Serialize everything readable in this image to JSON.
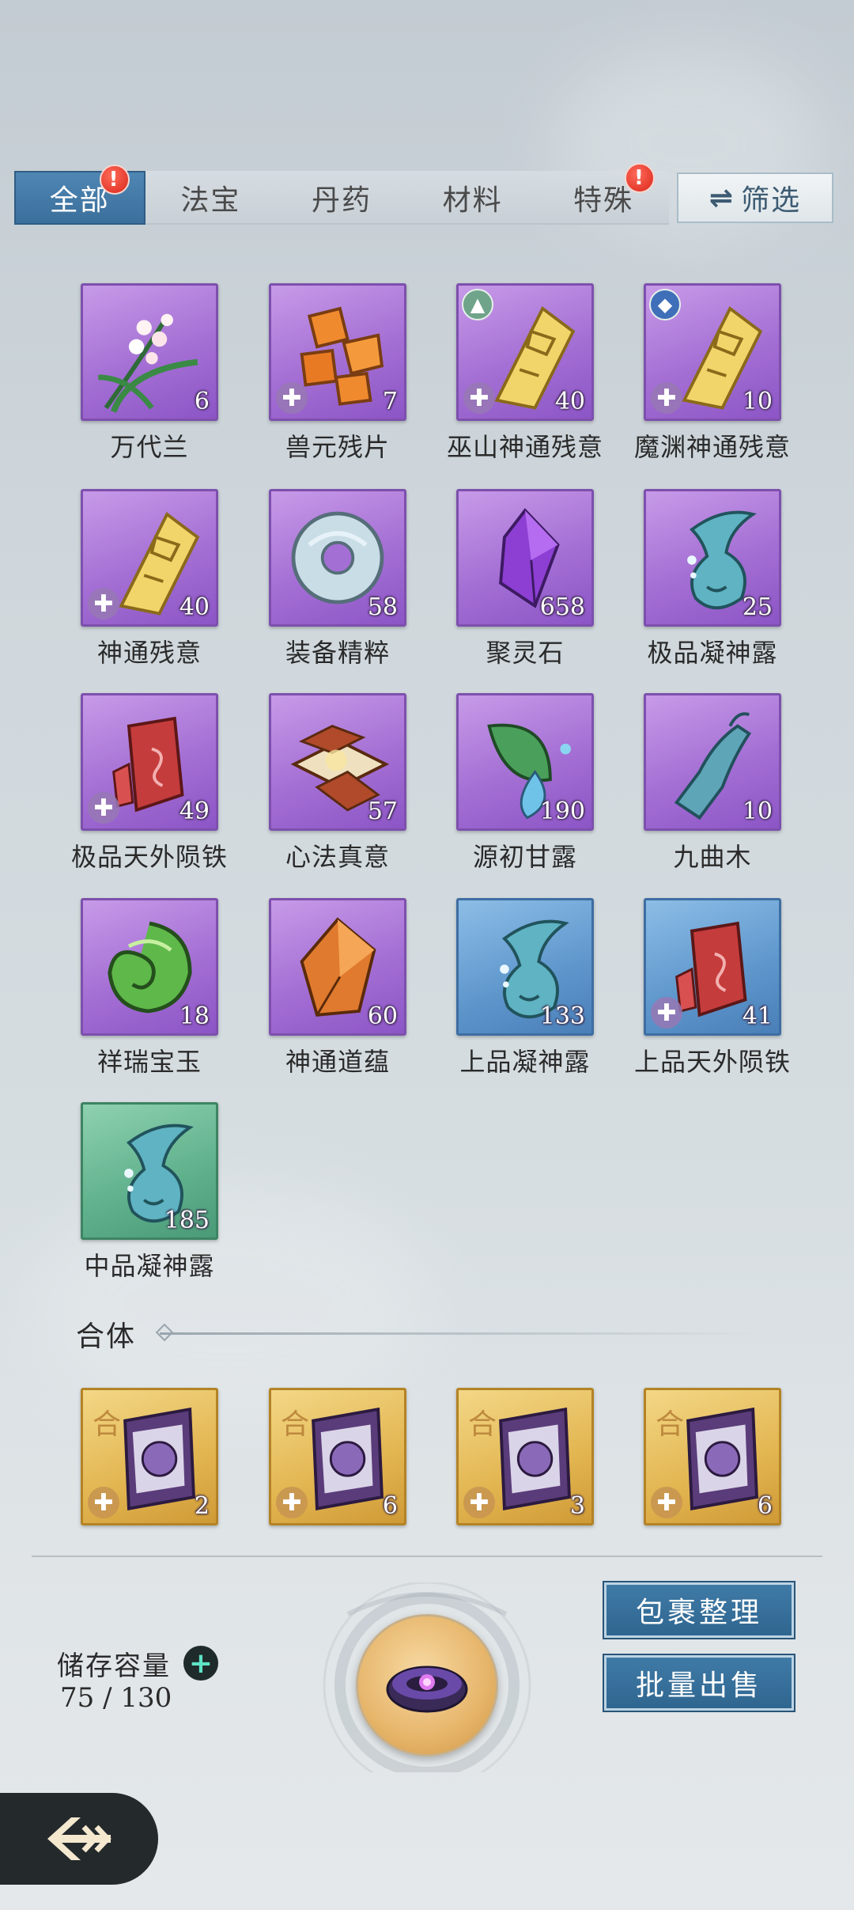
{
  "tabs": [
    {
      "label": "全部",
      "active": true,
      "badge": "!"
    },
    {
      "label": "法宝",
      "active": false,
      "badge": ""
    },
    {
      "label": "丹药",
      "active": false,
      "badge": ""
    },
    {
      "label": "材料",
      "active": false,
      "badge": ""
    },
    {
      "label": "特殊",
      "active": false,
      "badge": "!"
    }
  ],
  "filter": {
    "icon": "swap-arrows-icon",
    "label": "筛选"
  },
  "items": [
    {
      "name": "万代兰",
      "qty": "6",
      "rarity": "purple",
      "icon": "orchid-icon",
      "fragment": false
    },
    {
      "name": "兽元残片",
      "qty": "7",
      "rarity": "purple",
      "icon": "beast-shard-icon",
      "fragment": true
    },
    {
      "name": "巫山神通残意",
      "qty": "40",
      "rarity": "purple",
      "icon": "scroll-fragment-icon",
      "fragment": true,
      "sect": "mountain"
    },
    {
      "name": "魔渊神通残意",
      "qty": "10",
      "rarity": "purple",
      "icon": "scroll-fragment-icon",
      "fragment": true,
      "sect": "abyss"
    },
    {
      "name": "神通残意",
      "qty": "40",
      "rarity": "purple",
      "icon": "scroll-fragment-icon",
      "fragment": true
    },
    {
      "name": "装备精粹",
      "qty": "58",
      "rarity": "purple",
      "icon": "jade-disc-icon",
      "fragment": false
    },
    {
      "name": "聚灵石",
      "qty": "658",
      "rarity": "purple",
      "icon": "spirit-crystal-icon",
      "fragment": false
    },
    {
      "name": "极品凝神露",
      "qty": "25",
      "rarity": "purple",
      "icon": "dew-gourd-icon",
      "fragment": false
    },
    {
      "name": "极品天外陨铁",
      "qty": "49",
      "rarity": "purple",
      "icon": "meteor-iron-icon",
      "fragment": true
    },
    {
      "name": "心法真意",
      "qty": "57",
      "rarity": "purple",
      "icon": "ancient-books-icon",
      "fragment": false
    },
    {
      "name": "源初甘露",
      "qty": "190",
      "rarity": "purple",
      "icon": "leaf-dew-icon",
      "fragment": false
    },
    {
      "name": "九曲木",
      "qty": "10",
      "rarity": "purple",
      "icon": "twisted-wood-icon",
      "fragment": false
    },
    {
      "name": "祥瑞宝玉",
      "qty": "18",
      "rarity": "purple",
      "icon": "green-jade-icon",
      "fragment": false
    },
    {
      "name": "神通道蕴",
      "qty": "60",
      "rarity": "purple",
      "icon": "amber-crystal-icon",
      "fragment": false
    },
    {
      "name": "上品凝神露",
      "qty": "133",
      "rarity": "blue",
      "icon": "dew-gourd-icon",
      "fragment": false
    },
    {
      "name": "上品天外陨铁",
      "qty": "41",
      "rarity": "blue",
      "icon": "meteor-iron-icon",
      "fragment": true
    },
    {
      "name": "中品凝神露",
      "qty": "185",
      "rarity": "green",
      "icon": "dew-gourd-icon",
      "fragment": false
    }
  ],
  "section": {
    "title": "合体"
  },
  "merge_items": [
    {
      "char": "合",
      "qty": "2",
      "icon": "merge-scroll-icon"
    },
    {
      "char": "合",
      "qty": "6",
      "icon": "merge-scroll-icon"
    },
    {
      "char": "合",
      "qty": "3",
      "icon": "merge-scroll-icon"
    },
    {
      "char": "合",
      "qty": "6",
      "icon": "merge-scroll-icon"
    }
  ],
  "storage": {
    "label": "储存容量",
    "value": "75 / 130"
  },
  "buttons": {
    "organize": "包裹整理",
    "bulk_sell": "批量出售"
  },
  "colors": {
    "accent": "#3b6f9c",
    "purple": "#a46fd4",
    "blue": "#5e96cc",
    "green": "#5fb08c",
    "gold": "#e2b550"
  }
}
